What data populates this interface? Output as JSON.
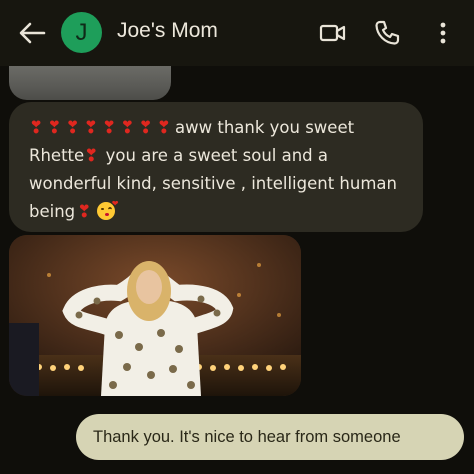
{
  "header": {
    "contact_name": "Joe's Mom",
    "avatar_initial": "J",
    "avatar_color": "#1e9e5a",
    "icons": [
      "back-arrow-icon",
      "video-call-icon",
      "phone-icon",
      "more-vert-icon"
    ]
  },
  "messages": {
    "incoming_text": {
      "line1": "aww thank you sweet",
      "line2_name": "Rhette",
      "line2_rest": " you are a sweet soul and a",
      "line3": "wonderful kind, sensitive , intelligent human",
      "line4": "being",
      "heart_emoji_count": 8,
      "emoji": [
        "heart-exclamation-emoji",
        "kissing-face-with-heart-emoji"
      ]
    },
    "outgoing_text": "Thank you. It's nice to hear from someone"
  },
  "colors": {
    "background": "#0f0e0a",
    "incoming_bubble": "#2d2b22",
    "outgoing_bubble": "#d6d4b4",
    "heart": "#e0271f"
  }
}
